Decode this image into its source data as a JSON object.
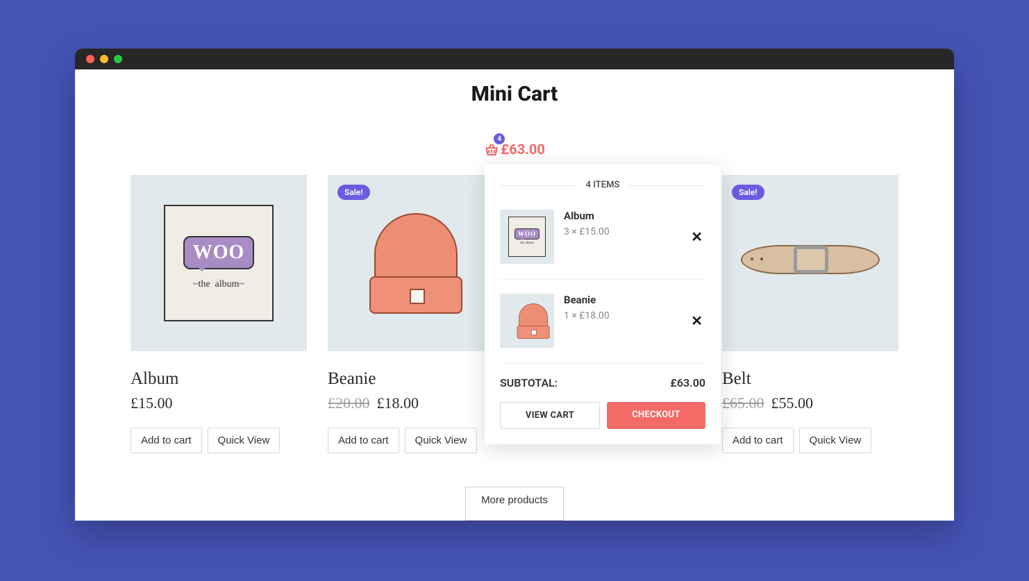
{
  "page_title": "Mini Cart",
  "cart": {
    "badge_count": "4",
    "total": "£63.00",
    "header": "4 ITEMS",
    "items": [
      {
        "name": "Album",
        "qty_price": "3 × £15.00"
      },
      {
        "name": "Beanie",
        "qty_price": "1 × £18.00"
      }
    ],
    "subtotal_label": "SUBTOTAL:",
    "subtotal_value": "£63.00",
    "view_cart": "VIEW CART",
    "checkout": "CHECKOUT"
  },
  "products": [
    {
      "title": "Album",
      "price": "£15.00",
      "old_price": "",
      "sale": false
    },
    {
      "title": "Beanie",
      "price": "£18.00",
      "old_price": "£20.00",
      "sale": true
    },
    {
      "title": "",
      "price": "",
      "old_price": "",
      "sale": false
    },
    {
      "title": "Belt",
      "price": "£55.00",
      "old_price": "£65.00",
      "sale": true
    }
  ],
  "labels": {
    "add_to_cart": "Add to cart",
    "quick_view": "Quick View",
    "more_products": "More products",
    "sale": "Sale!"
  }
}
